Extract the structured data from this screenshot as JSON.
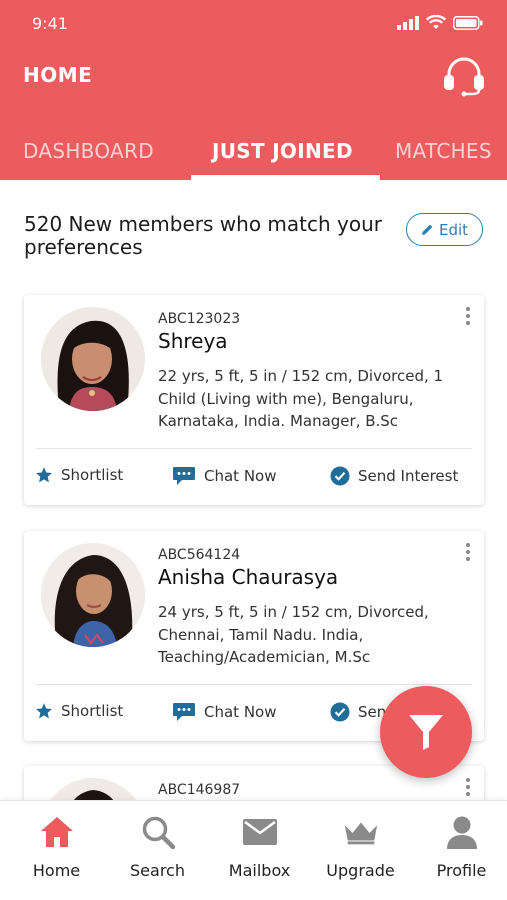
{
  "status_bar": {
    "time": "9:41"
  },
  "header": {
    "title": "HOME",
    "support_icon": "headset-icon"
  },
  "tabs": [
    {
      "label": "DASHBOARD",
      "active": false
    },
    {
      "label": "JUST JOINED",
      "active": true
    },
    {
      "label": "MATCHES",
      "active": false
    }
  ],
  "intro": {
    "text": "520 New members who match your preferences",
    "edit_label": "Edit"
  },
  "members": [
    {
      "id": "ABC123023",
      "name": "Shreya",
      "details": "22 yrs, 5 ft, 5 in / 152 cm, Divorced, 1 Child (Living with me), Bengaluru, Karnataka, India. Manager, B.Sc"
    },
    {
      "id": "ABC564124",
      "name": "Anisha Chaurasya",
      "details": "24 yrs, 5 ft, 5 in / 152 cm, Divorced, Chennai, Tamil Nadu. India, Teaching/Academician, M.Sc"
    },
    {
      "id": "ABC146987",
      "name": "",
      "details": ""
    }
  ],
  "actions": {
    "shortlist": "Shortlist",
    "chat": "Chat Now",
    "interest": "Send Interest"
  },
  "bottom_nav": [
    {
      "label": "Home",
      "icon": "home-icon",
      "active": true
    },
    {
      "label": "Search",
      "icon": "search-icon",
      "active": false
    },
    {
      "label": "Mailbox",
      "icon": "mail-icon",
      "active": false
    },
    {
      "label": "Upgrade",
      "icon": "crown-icon",
      "active": false
    },
    {
      "label": "Profile",
      "icon": "person-icon",
      "active": false
    }
  ],
  "colors": {
    "brand": "#ec5c5e",
    "accent": "#2c7fb0",
    "action_icon": "#1f6d98",
    "inactive_icon": "#8a8a8a"
  }
}
